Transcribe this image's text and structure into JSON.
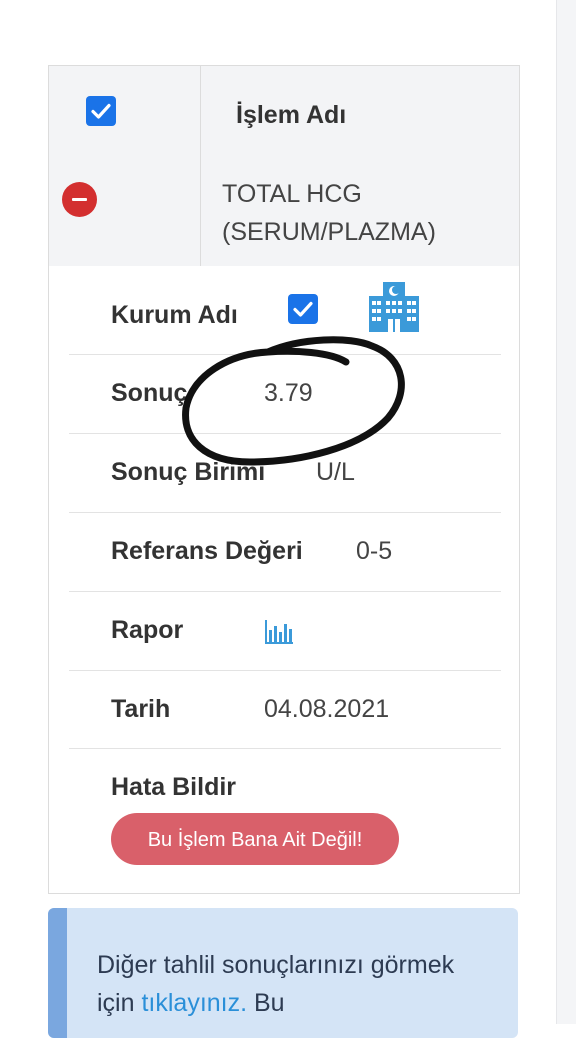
{
  "table": {
    "header_title": "İşlem Adı",
    "test_name_line1": "TOTAL HCG",
    "test_name_line2": "(SERUM/PLAZMA)"
  },
  "details": {
    "institution_label": "Kurum Adı",
    "result_label": "Sonuç",
    "result_value": "3.79",
    "unit_label": "Sonuç Birimi",
    "unit_value": "U/L",
    "reference_label": "Referans Değeri",
    "reference_value": "0-5",
    "report_label": "Rapor",
    "date_label": "Tarih",
    "date_value": "04.08.2021",
    "error_label": "Hata Bildir",
    "error_button": "Bu İşlem Bana Ait Değil!"
  },
  "alert": {
    "text_before": "Diğer tahlil sonuçlarınızı görmek için ",
    "link": "tıklayınız.",
    "text_after": " Bu"
  },
  "icons": [
    "checkbox-checked-icon",
    "remove-circle-icon",
    "hospital-icon",
    "bar-chart-icon"
  ],
  "colors": {
    "checkbox_blue": "#1a73e8",
    "remove_red": "#d32f2f",
    "error_button": "#d9606a",
    "icon_blue": "#3b9ad9",
    "alert_bg": "#d4e4f6",
    "alert_bar": "#7aa7df",
    "link": "#2a8fd8"
  }
}
